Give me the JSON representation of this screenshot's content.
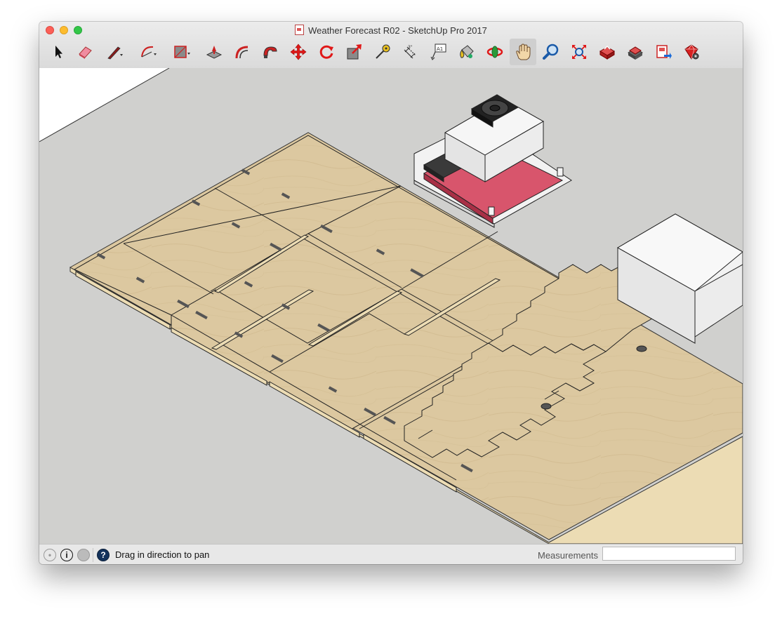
{
  "window": {
    "title": "Weather Forecast R02 - SketchUp Pro 2017"
  },
  "toolbar": {
    "tools": [
      {
        "name": "select-tool-icon"
      },
      {
        "name": "eraser-tool-icon"
      },
      {
        "name": "line-tool-icon",
        "has_dropdown": true
      },
      {
        "name": "arc-tool-icon",
        "has_dropdown": true
      },
      {
        "name": "rectangle-tool-icon",
        "has_dropdown": true
      },
      {
        "name": "push-pull-tool-icon"
      },
      {
        "name": "offset-tool-icon"
      },
      {
        "name": "follow-me-tool-icon"
      },
      {
        "name": "move-tool-icon"
      },
      {
        "name": "rotate-tool-icon"
      },
      {
        "name": "scale-tool-icon"
      },
      {
        "name": "tape-measure-tool-icon"
      },
      {
        "name": "dimension-tool-icon"
      },
      {
        "name": "text-tool-icon",
        "label": "A1"
      },
      {
        "name": "paint-bucket-tool-icon"
      },
      {
        "name": "orbit-tool-icon"
      },
      {
        "name": "pan-tool-icon",
        "active": true
      },
      {
        "name": "zoom-tool-icon"
      },
      {
        "name": "zoom-extents-tool-icon"
      },
      {
        "name": "warehouse-tool-icon"
      },
      {
        "name": "extension-warehouse-tool-icon"
      },
      {
        "name": "layout-tool-icon"
      },
      {
        "name": "extension-manager-tool-icon"
      }
    ]
  },
  "colors": {
    "plywood": "#dcc8a0",
    "plywood_edge": "#ecdcb4",
    "canvas_bg": "#d0d0ce",
    "pcb_red": "#d8556c",
    "box_white": "#e4e4e4"
  },
  "status": {
    "text": "Drag in direction to pan",
    "measurements_label": "Measurements",
    "measurements_value": ""
  }
}
